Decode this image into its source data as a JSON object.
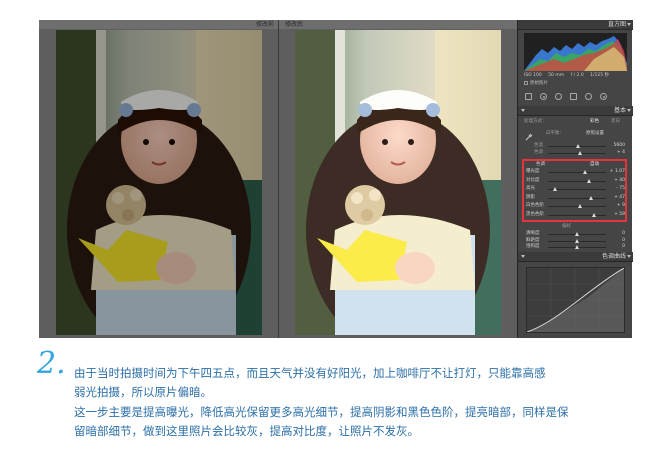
{
  "window": {
    "before_label": "修改前",
    "after_label": "修改后"
  },
  "panel": {
    "histogram_title": "直方图",
    "readout": [
      "ISO 100",
      "50 mm",
      "f / 2.0",
      "1/125 秒"
    ],
    "original_photo": "原始照片",
    "basic_title": "基本",
    "treatment_label": "处理方式：",
    "treatment_color": "彩色",
    "treatment_bw": "黑白",
    "profile_label": "白平衡：",
    "profile_value": "原照设置",
    "temp_label": "色温",
    "temp_value": "5600",
    "tint_label": "色调",
    "tint_value": "+ 4",
    "tone_label": "色调",
    "auto_label": "自动",
    "sliders": [
      {
        "label": "曝光度",
        "value": "+ 1.07",
        "pos": 0.64
      },
      {
        "label": "对比度",
        "value": "+ 40",
        "pos": 0.7
      },
      {
        "label": "高光",
        "value": "- 75",
        "pos": 0.12
      },
      {
        "label": "阴影",
        "value": "+ 47",
        "pos": 0.74
      },
      {
        "label": "白色色阶",
        "value": "+ 9",
        "pos": 0.55
      },
      {
        "label": "黑色色阶",
        "value": "+ 59",
        "pos": 0.8
      }
    ],
    "presence_label": "偏好",
    "presence": [
      {
        "label": "清晰度",
        "value": "0",
        "pos": 0.5
      },
      {
        "label": "鲜艳度",
        "value": "0",
        "pos": 0.5
      },
      {
        "label": "饱和度",
        "value": "0",
        "pos": 0.5
      }
    ],
    "curve_title": "色调曲线"
  },
  "caption": {
    "step_number": "2.",
    "lines": [
      "由于当时拍摄时间为下午四五点，而且天气并没有好阳光，加上咖啡厅不让打灯，只能靠高感",
      "弱光拍摄，所以原片偏暗。",
      "这一步主要是提高曝光，降低高光保留更多高光细节，提高阴影和黑色色阶，提亮暗部，同样是保",
      "留暗部细节，做到这里照片会比较灰，提高对比度，让照片不发灰。"
    ]
  },
  "colors": {
    "accent_blue": "#35a7dc",
    "caption_blue": "#2c6fa8",
    "highlight_red": "#e5353a"
  }
}
